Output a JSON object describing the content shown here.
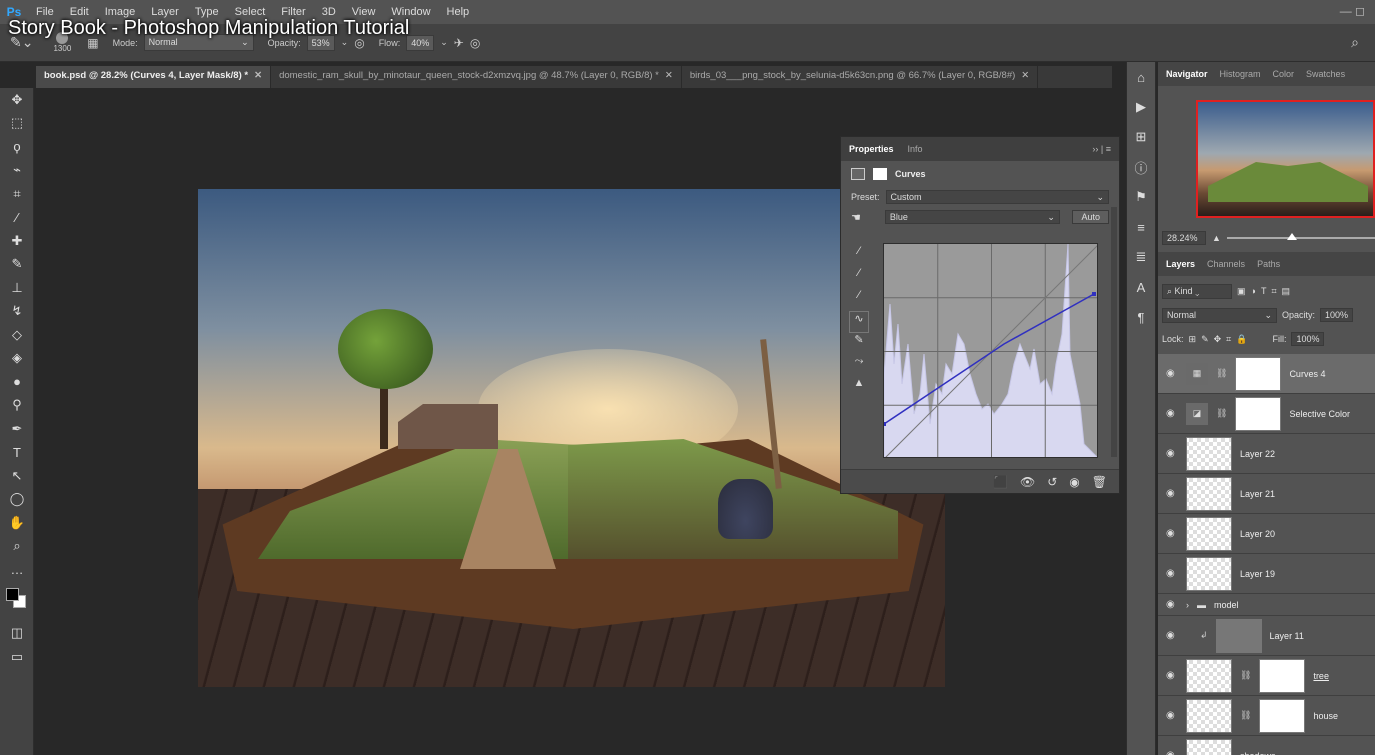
{
  "overlay_title": "Story Book - Photoshop Manipulation Tutorial",
  "menubar": {
    "items": [
      "File",
      "Edit",
      "Image",
      "Layer",
      "Type",
      "Select",
      "Filter",
      "3D",
      "View",
      "Window",
      "Help"
    ],
    "window_controls": "— ◻"
  },
  "options": {
    "brush_size": "1300",
    "mode_label": "Mode:",
    "mode_value": "Normal",
    "opacity_label": "Opacity:",
    "opacity_value": "53%",
    "flow_label": "Flow:",
    "flow_value": "40%"
  },
  "tabs": [
    {
      "label": "book.psd @ 28.2% (Curves 4, Layer Mask/8) *"
    },
    {
      "label": "domestic_ram_skull_by_minotaur_queen_stock-d2xmzvq.jpg @ 48.7% (Layer 0, RGB/8) *"
    },
    {
      "label": "birds_03___png_stock_by_selunia-d5k63cn.png @ 66.7% (Layer 0, RGB/8#)"
    }
  ],
  "properties_panel": {
    "tabs": [
      "Properties",
      "Info"
    ],
    "adjustment_name": "Curves",
    "preset_label": "Preset:",
    "preset_value": "Custom",
    "channel_value": "Blue",
    "auto_button": "Auto"
  },
  "navigator": {
    "tabs": [
      "Navigator",
      "Histogram",
      "Color",
      "Swatches"
    ],
    "zoom": "28.24%"
  },
  "layers_panel": {
    "tabs": [
      "Layers",
      "Channels",
      "Paths"
    ],
    "kind_label": "Kind",
    "blend_mode": "Normal",
    "opacity_label": "Opacity:",
    "opacity_value": "100%",
    "lock_label": "Lock:",
    "fill_label": "Fill:",
    "fill_value": "100%",
    "layers": [
      {
        "name": "Curves 4"
      },
      {
        "name": "Selective Color"
      },
      {
        "name": "Layer 22"
      },
      {
        "name": "Layer 21"
      },
      {
        "name": "Layer 20"
      },
      {
        "name": "Layer 19"
      },
      {
        "name": "model"
      },
      {
        "name": "Layer 11"
      },
      {
        "name": "tree"
      },
      {
        "name": "house"
      },
      {
        "name": "shadows"
      }
    ]
  },
  "colors": {
    "panel_bg": "#535353",
    "canvas_bg": "#282828",
    "navigator_border": "#e02020",
    "curve_line": "#3030c0",
    "histogram_fill": "#d8d8f0"
  }
}
